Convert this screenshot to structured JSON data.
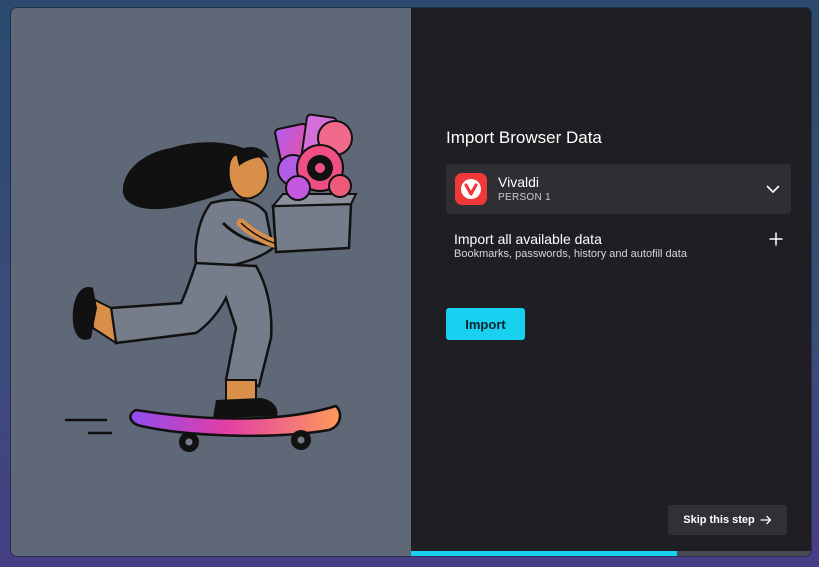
{
  "dialog": {
    "title": "Import Browser Data",
    "source": {
      "browser": "Vivaldi",
      "profile": "PERSON 1",
      "icon": "vivaldi-logo-icon",
      "icon_color": "#ef3939"
    },
    "import_all": {
      "title": "Import all available data",
      "subtitle": "Bookmarks, passwords, history and autofill data",
      "icon": "plus-icon"
    },
    "import_button": "Import",
    "skip_button": "Skip this step",
    "skip_icon": "arrow-right-icon",
    "progress": 0.665
  },
  "colors": {
    "accent": "#19d0f0",
    "panel_dark": "#1f1f23",
    "illustration_bg": "#5f6877"
  },
  "illustration": {
    "icon": "skateboarding-girl-with-box-illustration"
  }
}
